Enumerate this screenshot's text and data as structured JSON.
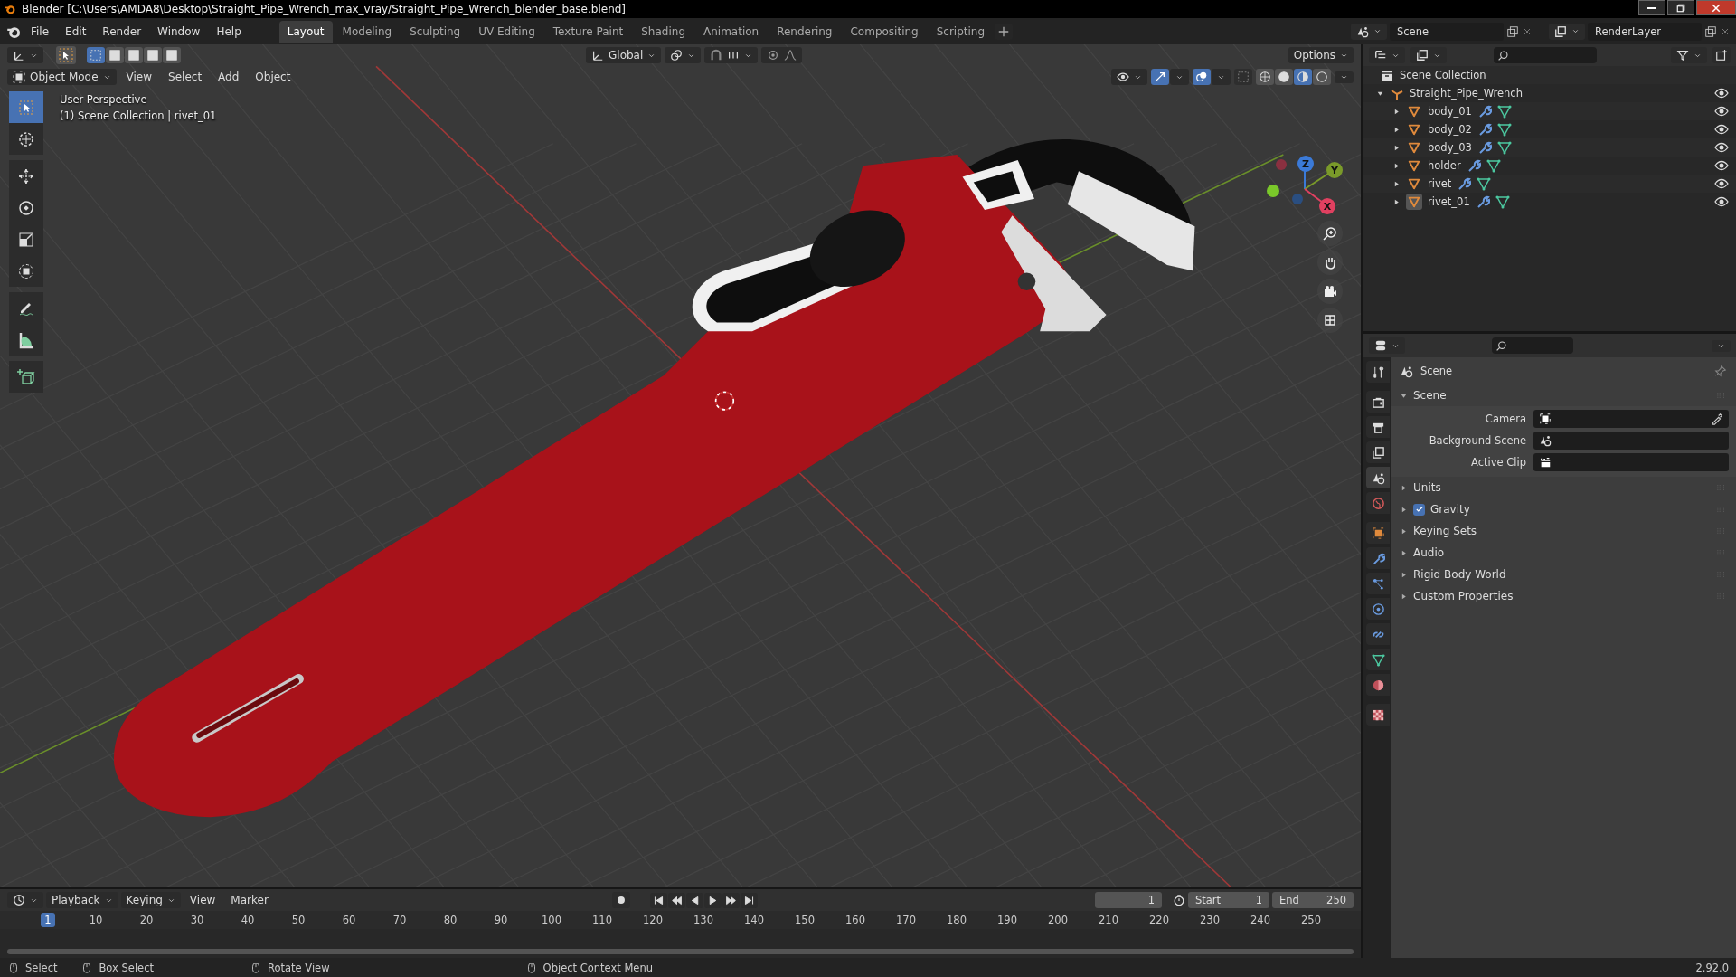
{
  "window": {
    "title": "Blender [C:\\Users\\AMDA8\\Desktop\\Straight_Pipe_Wrench_max_vray/Straight_Pipe_Wrench_blender_base.blend]"
  },
  "menu": [
    "File",
    "Edit",
    "Render",
    "Window",
    "Help"
  ],
  "workspaces": [
    {
      "label": "Layout",
      "selected": true
    },
    {
      "label": "Modeling",
      "selected": false
    },
    {
      "label": "Sculpting",
      "selected": false
    },
    {
      "label": "UV Editing",
      "selected": false
    },
    {
      "label": "Texture Paint",
      "selected": false
    },
    {
      "label": "Shading",
      "selected": false
    },
    {
      "label": "Animation",
      "selected": false
    },
    {
      "label": "Rendering",
      "selected": false
    },
    {
      "label": "Compositing",
      "selected": false
    },
    {
      "label": "Scripting",
      "selected": false
    }
  ],
  "scene": "Scene",
  "view_layer": "RenderLayer",
  "viewport": {
    "orientation": "Global",
    "options": "Options",
    "mode": "Object Mode",
    "menus": [
      "View",
      "Select",
      "Add",
      "Object"
    ],
    "select_modes": [
      {
        "selected": true
      },
      {
        "selected": false
      },
      {
        "selected": false
      },
      {
        "selected": false
      },
      {
        "selected": false
      }
    ],
    "shading": [
      {
        "selected": false
      },
      {
        "selected": false
      },
      {
        "selected": true
      },
      {
        "selected": false
      }
    ],
    "overlay_lines": [
      "User Perspective",
      "(1) Scene Collection | rivet_01"
    ],
    "tools": [
      {
        "kind": "select",
        "selected": true
      },
      {
        "kind": "cursor",
        "selected": false
      },
      {
        "kind": "move",
        "selected": false
      },
      {
        "kind": "rotate",
        "selected": false
      },
      {
        "kind": "scale",
        "selected": false
      },
      {
        "kind": "transform",
        "selected": false
      },
      {
        "kind": "annotate",
        "selected": false
      },
      {
        "kind": "measure",
        "selected": false
      },
      {
        "kind": "add_cube",
        "selected": false
      }
    ],
    "gizmo": [
      {
        "label": "Z"
      },
      {
        "label": "Y"
      },
      {
        "label": "X"
      }
    ]
  },
  "outliner": {
    "root": "Scene Collection",
    "children": [
      {
        "name": "Straight_Pipe_Wrench",
        "kind": "collection",
        "expanded": true,
        "children": [
          {
            "name": "body_01",
            "kind": "object",
            "selected": false
          },
          {
            "name": "body_02",
            "kind": "object",
            "selected": false
          },
          {
            "name": "body_03",
            "kind": "object",
            "selected": false
          },
          {
            "name": "holder",
            "kind": "object",
            "selected": false
          },
          {
            "name": "rivet",
            "kind": "object",
            "selected": false
          },
          {
            "name": "rivet_01",
            "kind": "object",
            "selected": true
          }
        ]
      }
    ]
  },
  "properties": {
    "context": "Scene",
    "tabs": [
      {
        "kind": "tool",
        "selected": false
      },
      {
        "kind": "render",
        "selected": false
      },
      {
        "kind": "output",
        "selected": false
      },
      {
        "kind": "view_layer",
        "selected": false
      },
      {
        "kind": "scene",
        "selected": true
      },
      {
        "kind": "world",
        "selected": false
      },
      {
        "kind": "object",
        "selected": false
      },
      {
        "kind": "modifiers",
        "selected": false
      },
      {
        "kind": "particles",
        "selected": false
      },
      {
        "kind": "physics",
        "selected": false
      },
      {
        "kind": "constraints",
        "selected": false
      },
      {
        "kind": "data",
        "selected": false
      },
      {
        "kind": "material",
        "selected": false
      },
      {
        "kind": "texture",
        "selected": false
      }
    ],
    "panels": [
      {
        "title": "Scene",
        "kind": "plain",
        "expanded": true,
        "fields": [
          {
            "label": "Camera",
            "kind": "camera"
          },
          {
            "label": "Background Scene",
            "kind": "scene"
          },
          {
            "label": "Active Clip",
            "kind": "clip"
          }
        ]
      },
      {
        "title": "Units",
        "kind": "plain",
        "expanded": false
      },
      {
        "title": "Gravity",
        "kind": "checkbox",
        "checked": true,
        "expanded": false
      },
      {
        "title": "Keying Sets",
        "kind": "plain",
        "expanded": false
      },
      {
        "title": "Audio",
        "kind": "plain",
        "expanded": false
      },
      {
        "title": "Rigid Body World",
        "kind": "plain",
        "expanded": false
      },
      {
        "title": "Custom Properties",
        "kind": "plain",
        "expanded": false
      }
    ]
  },
  "timeline": {
    "menus": [
      "Playback",
      "Keying",
      "View",
      "Marker"
    ],
    "current_frame": "1",
    "start_label": "Start",
    "start": "1",
    "end_label": "End",
    "end": "250",
    "ruler": [
      {
        "label": "1",
        "selected": true
      },
      {
        "label": "10",
        "selected": false
      },
      {
        "label": "20",
        "selected": false
      },
      {
        "label": "30",
        "selected": false
      },
      {
        "label": "40",
        "selected": false
      },
      {
        "label": "50",
        "selected": false
      },
      {
        "label": "60",
        "selected": false
      },
      {
        "label": "70",
        "selected": false
      },
      {
        "label": "80",
        "selected": false
      },
      {
        "label": "90",
        "selected": false
      },
      {
        "label": "100",
        "selected": false
      },
      {
        "label": "110",
        "selected": false
      },
      {
        "label": "120",
        "selected": false
      },
      {
        "label": "130",
        "selected": false
      },
      {
        "label": "140",
        "selected": false
      },
      {
        "label": "150",
        "selected": false
      },
      {
        "label": "160",
        "selected": false
      },
      {
        "label": "170",
        "selected": false
      },
      {
        "label": "180",
        "selected": false
      },
      {
        "label": "190",
        "selected": false
      },
      {
        "label": "200",
        "selected": false
      },
      {
        "label": "210",
        "selected": false
      },
      {
        "label": "220",
        "selected": false
      },
      {
        "label": "230",
        "selected": false
      },
      {
        "label": "240",
        "selected": false
      },
      {
        "label": "250",
        "selected": false
      }
    ]
  },
  "status_bar": {
    "hints": [
      "Select",
      "Box Select",
      "Rotate View",
      "Object Context Menu"
    ],
    "version": "2.92.0"
  }
}
